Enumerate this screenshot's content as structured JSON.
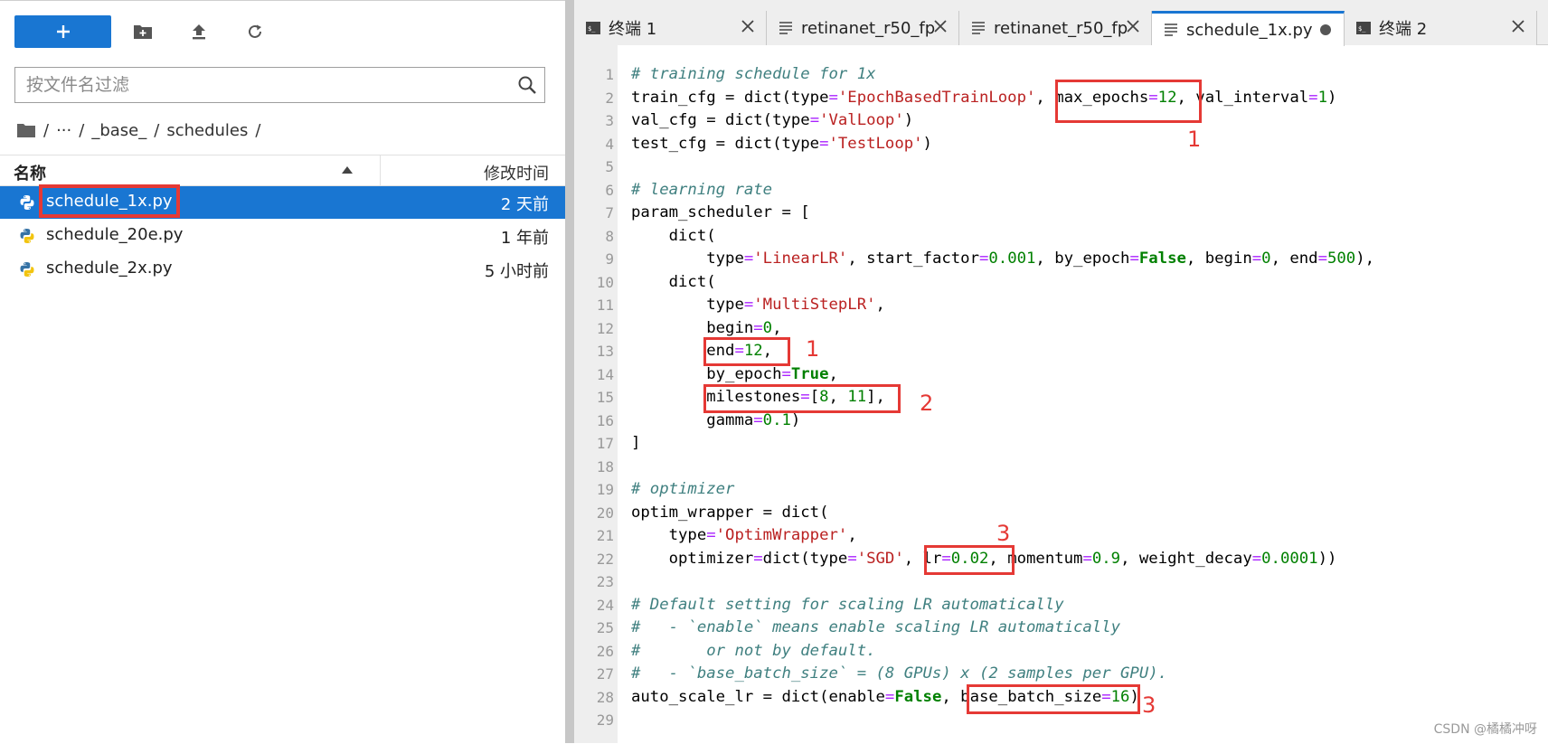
{
  "filebrowser": {
    "filter_placeholder": "按文件名过滤",
    "breadcrumb": [
      "/",
      "···",
      "/",
      "_base_",
      "/",
      "schedules",
      "/"
    ],
    "columns": {
      "name": "名称",
      "modified": "修改时间"
    },
    "files": [
      {
        "name": "schedule_1x.py",
        "modified": "2 天前",
        "selected": true
      },
      {
        "name": "schedule_20e.py",
        "modified": "1 年前",
        "selected": false
      },
      {
        "name": "schedule_2x.py",
        "modified": "5 小时前",
        "selected": false
      }
    ]
  },
  "tabs": [
    {
      "label": "终端 1",
      "type": "terminal"
    },
    {
      "label": "retinanet_r50_fp",
      "type": "text"
    },
    {
      "label": "retinanet_r50_fp",
      "type": "text"
    },
    {
      "label": "schedule_1x.py",
      "type": "text",
      "active": true,
      "modified": true
    },
    {
      "label": "终端 2",
      "type": "terminal"
    }
  ],
  "editor": {
    "line_count": 29,
    "lines": [
      [
        [
          "cm",
          "# training schedule for 1x"
        ]
      ],
      [
        [
          "",
          "train_cfg = dict(type"
        ],
        [
          "op",
          "="
        ],
        [
          "st",
          "'EpochBasedTrainLoop'"
        ],
        [
          "",
          ", max_epochs"
        ],
        [
          "op",
          "="
        ],
        [
          "nu",
          "12"
        ],
        [
          "",
          ", val_interval"
        ],
        [
          "op",
          "="
        ],
        [
          "nu",
          "1"
        ],
        [
          "",
          ")"
        ]
      ],
      [
        [
          "",
          "val_cfg = dict(type"
        ],
        [
          "op",
          "="
        ],
        [
          "st",
          "'ValLoop'"
        ],
        [
          "",
          ")"
        ]
      ],
      [
        [
          "",
          "test_cfg = dict(type"
        ],
        [
          "op",
          "="
        ],
        [
          "st",
          "'TestLoop'"
        ],
        [
          "",
          ")"
        ]
      ],
      [],
      [
        [
          "cm",
          "# learning rate"
        ]
      ],
      [
        [
          "",
          "param_scheduler = ["
        ]
      ],
      [
        [
          "",
          "    dict("
        ]
      ],
      [
        [
          "",
          "        type"
        ],
        [
          "op",
          "="
        ],
        [
          "st",
          "'LinearLR'"
        ],
        [
          "",
          ", start_factor"
        ],
        [
          "op",
          "="
        ],
        [
          "nu",
          "0.001"
        ],
        [
          "",
          ", by_epoch"
        ],
        [
          "op",
          "="
        ],
        [
          "kw",
          "False"
        ],
        [
          "",
          ", begin"
        ],
        [
          "op",
          "="
        ],
        [
          "nu",
          "0"
        ],
        [
          "",
          ", end"
        ],
        [
          "op",
          "="
        ],
        [
          "nu",
          "500"
        ],
        [
          "",
          "),"
        ]
      ],
      [
        [
          "",
          "    dict("
        ]
      ],
      [
        [
          "",
          "        type"
        ],
        [
          "op",
          "="
        ],
        [
          "st",
          "'MultiStepLR'"
        ],
        [
          "",
          ","
        ]
      ],
      [
        [
          "",
          "        begin"
        ],
        [
          "op",
          "="
        ],
        [
          "nu",
          "0"
        ],
        [
          "",
          ","
        ]
      ],
      [
        [
          "",
          "        end"
        ],
        [
          "op",
          "="
        ],
        [
          "nu",
          "12"
        ],
        [
          "",
          ","
        ]
      ],
      [
        [
          "",
          "        by_epoch"
        ],
        [
          "op",
          "="
        ],
        [
          "kw",
          "True"
        ],
        [
          "",
          ","
        ]
      ],
      [
        [
          "",
          "        milestones"
        ],
        [
          "op",
          "="
        ],
        [
          "",
          "["
        ],
        [
          "nu",
          "8"
        ],
        [
          "",
          ", "
        ],
        [
          "nu",
          "11"
        ],
        [
          "",
          "],"
        ]
      ],
      [
        [
          "",
          "        gamma"
        ],
        [
          "op",
          "="
        ],
        [
          "nu",
          "0.1"
        ],
        [
          "",
          ")"
        ]
      ],
      [
        [
          "",
          "]"
        ]
      ],
      [],
      [
        [
          "cm",
          "# optimizer"
        ]
      ],
      [
        [
          "",
          "optim_wrapper = dict("
        ]
      ],
      [
        [
          "",
          "    type"
        ],
        [
          "op",
          "="
        ],
        [
          "st",
          "'OptimWrapper'"
        ],
        [
          "",
          ","
        ]
      ],
      [
        [
          "",
          "    optimizer"
        ],
        [
          "op",
          "="
        ],
        [
          "",
          "dict(type"
        ],
        [
          "op",
          "="
        ],
        [
          "st",
          "'SGD'"
        ],
        [
          "",
          ", lr"
        ],
        [
          "op",
          "="
        ],
        [
          "nu",
          "0.02"
        ],
        [
          "",
          ", momentum"
        ],
        [
          "op",
          "="
        ],
        [
          "nu",
          "0.9"
        ],
        [
          "",
          ", weight_decay"
        ],
        [
          "op",
          "="
        ],
        [
          "nu",
          "0.0001"
        ],
        [
          "",
          "))"
        ]
      ],
      [],
      [
        [
          "cm",
          "# Default setting for scaling LR automatically"
        ]
      ],
      [
        [
          "cm",
          "#   - `enable` means enable scaling LR automatically"
        ]
      ],
      [
        [
          "cm",
          "#       or not by default."
        ]
      ],
      [
        [
          "cm",
          "#   - `base_batch_size` = (8 GPUs) x (2 samples per GPU)."
        ]
      ],
      [
        [
          "",
          "auto_scale_lr = dict(enable"
        ],
        [
          "op",
          "="
        ],
        [
          "kw",
          "False"
        ],
        [
          "",
          ", base_batch_size"
        ],
        [
          "op",
          "="
        ],
        [
          "nu",
          "16"
        ],
        [
          "",
          ")"
        ]
      ],
      []
    ]
  },
  "annotations": {
    "a1": "1",
    "a2": "1",
    "a3": "2",
    "a4": "3",
    "a5": "3"
  },
  "watermark": "CSDN @橘橘冲呀",
  "colors": {
    "accent": "#1976d2",
    "highlight": "#e53935"
  }
}
